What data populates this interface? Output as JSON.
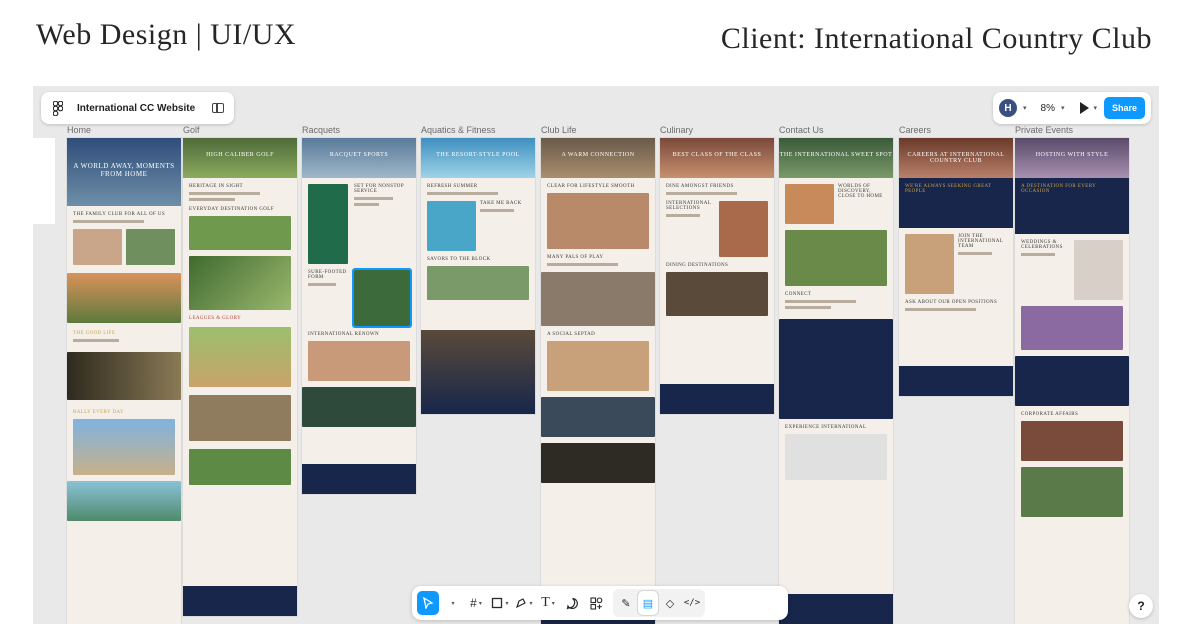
{
  "headings": {
    "left": "Web Design | UI/UX",
    "right": "Client: International Country Club"
  },
  "topbar": {
    "logo_icon": "figma-logo-icon",
    "file_name": "International CC Website"
  },
  "rightbar": {
    "avatar_initial": "H",
    "zoom": "8%",
    "share_label": "Share"
  },
  "frames": [
    {
      "label": "Home",
      "hero": "A WORLD AWAY, MOMENTS FROM HOME",
      "c1": "THE FAMILY CLUB FOR ALL OF US",
      "c2": "THE GOOD LIFE",
      "c3": "RALLY EVERY DAY"
    },
    {
      "label": "Golf",
      "hero": "HIGH CALIBER GOLF",
      "c1": "HERITAGE IN SIGHT",
      "c2": "EVERYDAY DESTINATION GOLF",
      "c3": "LEAGUES & GLORY"
    },
    {
      "label": "Racquets",
      "hero": "RACQUET SPORTS",
      "c1": "SET FOR NONSTOP SERVICE",
      "c2": "SURE-FOOTED FORM",
      "c3": "INTERNATIONAL RENOWN"
    },
    {
      "label": "Aquatics & Fitness",
      "hero": "THE RESORT-STYLE POOL",
      "c1": "REFRESH SUMMER",
      "c2": "TAKE ME BACK",
      "c3": "SAVORS TO THE BLOCK"
    },
    {
      "label": "Club Life",
      "hero": "A WARM CONNECTION",
      "c1": "CLEAR FOR LIFESTYLE SMOOTH",
      "c2": "MANY PALS OF PLAY",
      "c3": "A SOCIAL SEPTAD"
    },
    {
      "label": "Culinary",
      "hero": "BEST CLASS OF THE CLASS",
      "c1": "DINE AMONGST FRIENDS",
      "c2": "INTERNATIONAL SELECTIONS",
      "c3": "DINING DESTINATIONS"
    },
    {
      "label": "Contact Us",
      "hero": "THE INTERNATIONAL SWEET SPOT",
      "c1": "WORLDS OF DISCOVERY, CLOSE TO HOME",
      "c2": "CONNECT",
      "c3": "EXPERIENCE INTERNATIONAL"
    },
    {
      "label": "Careers",
      "hero": "CAREERS AT INTERNATIONAL COUNTRY CLUB",
      "c1": "WE'RE ALWAYS SEEKING GREAT PEOPLE",
      "c2": "JOIN THE INTERNATIONAL TEAM",
      "c3": "ASK ABOUT OUR OPEN POSITIONS"
    },
    {
      "label": "Private Events",
      "hero": "HOSTING WITH STYLE",
      "c1": "A DESTINATION FOR EVERY OCCASION",
      "c2": "WEDDINGS & CELEBRATIONS",
      "c3": "CORPORATE AFFAIRS"
    }
  ],
  "toolbar": {
    "move_icon": "move-cursor-icon",
    "frame_icon": "frame-hash-icon",
    "shape_icon": "rectangle-icon",
    "pen_icon": "pen-icon",
    "text_icon": "text-icon",
    "comment_icon": "comment-icon",
    "actions_icon": "actions-icon",
    "draw_icon": "draw-icon",
    "design_icon": "design-mode-icon",
    "dev_icon": "dev-mode-icon",
    "code_icon": "code-icon"
  },
  "help_label": "?"
}
